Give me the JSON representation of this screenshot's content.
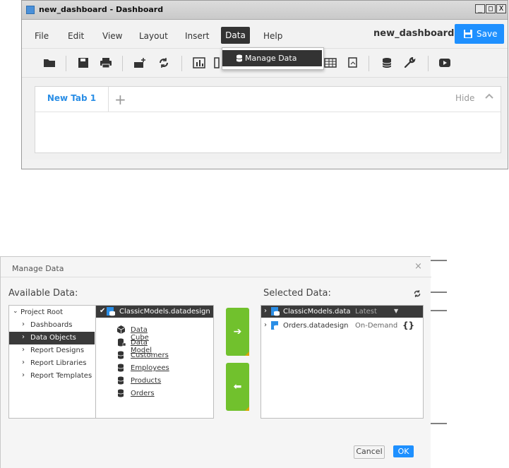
{
  "window": {
    "title": "new_dashboard - Dashboard",
    "controls": [
      "_",
      "□",
      "X"
    ]
  },
  "menubar": {
    "items": [
      "File",
      "Edit",
      "View",
      "Layout",
      "Insert",
      "Data",
      "Help"
    ],
    "active": "Data",
    "dashboard_name": "new_dashboard",
    "save_label": "Save"
  },
  "data_menu": {
    "items": [
      "Manage Data"
    ]
  },
  "toolbar": {
    "icons": [
      "folder-icon",
      "save-icon",
      "print-icon",
      "add-component-icon",
      "refresh-icon",
      "chart-icon",
      "table-icon",
      "image-icon",
      "database-icon",
      "wrench-icon",
      "play-icon"
    ]
  },
  "tabs": {
    "items": [
      "New Tab 1"
    ],
    "add": "+",
    "hide_label": "Hide"
  },
  "dialog": {
    "title": "Manage Data",
    "close": "×",
    "available_label": "Available Data:",
    "selected_label": "Selected Data:",
    "tree": [
      {
        "label": "Project Root",
        "expanded": true,
        "selected": false
      },
      {
        "label": "Dashboards",
        "expanded": false,
        "selected": false
      },
      {
        "label": "Data Objects",
        "expanded": false,
        "selected": true
      },
      {
        "label": "Report Designs",
        "expanded": false,
        "selected": false
      },
      {
        "label": "Report Libraries",
        "expanded": false,
        "selected": false
      },
      {
        "label": "Report Templates",
        "expanded": false,
        "selected": false
      }
    ],
    "objects_header": "ClassicModels.datadesign",
    "objects": [
      "Data Cube",
      "Data Model",
      "Customers",
      "Employees",
      "Products",
      "Orders"
    ],
    "selected": [
      {
        "label": "ClassicModels.data",
        "version": "Latest",
        "extra": "▼"
      },
      {
        "label": "Orders.datadesign",
        "version": "On-Demand",
        "extra": "{}"
      }
    ],
    "move_right": "➔",
    "move_left": "⬅",
    "cancel_label": "Cancel",
    "ok_label": "OK"
  },
  "colors": {
    "accent_blue": "#1e90ff",
    "green": "#71c12d",
    "dark": "#333333"
  }
}
